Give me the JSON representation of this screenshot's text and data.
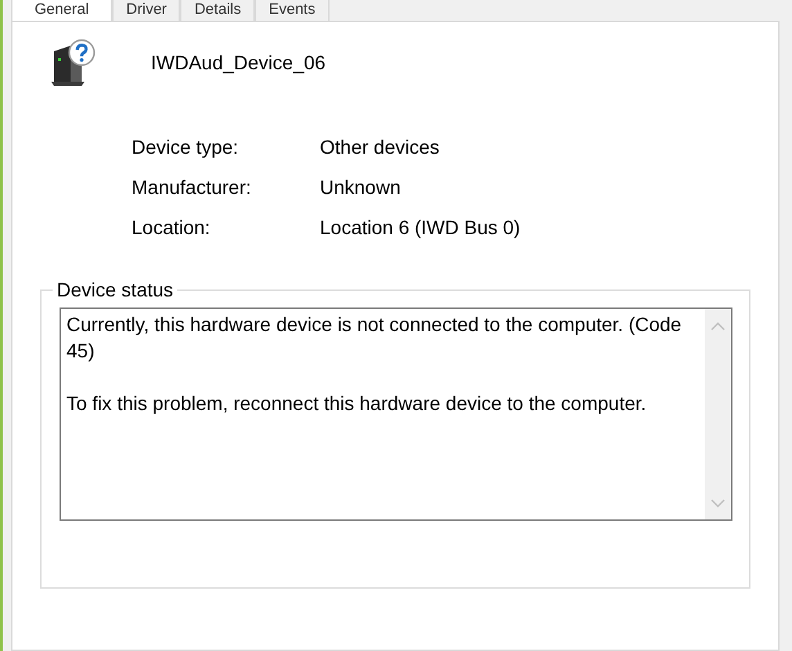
{
  "tabs": [
    {
      "label": "General",
      "selected": true
    },
    {
      "label": "Driver",
      "selected": false
    },
    {
      "label": "Details",
      "selected": false
    },
    {
      "label": "Events",
      "selected": false
    }
  ],
  "device": {
    "name": "IWDAud_Device_06"
  },
  "properties": [
    {
      "label": "Device type:",
      "value": "Other devices"
    },
    {
      "label": "Manufacturer:",
      "value": "Unknown"
    },
    {
      "label": "Location:",
      "value": "Location 6 (IWD Bus 0)"
    }
  ],
  "device_status": {
    "title": "Device status",
    "paragraphs": [
      "Currently, this hardware device is not connected to the computer. (Code 45)",
      "To fix this problem, reconnect this hardware device to the computer."
    ]
  }
}
